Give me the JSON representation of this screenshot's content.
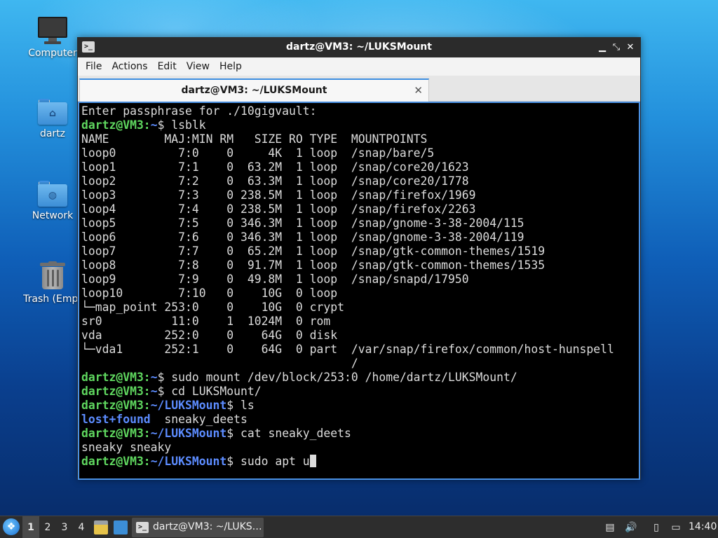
{
  "desktop": {
    "icons": [
      {
        "label": "Computer",
        "icon": "computer-icon"
      },
      {
        "label": "dartz",
        "icon": "home-folder-icon"
      },
      {
        "label": "Network",
        "icon": "network-folder-icon"
      },
      {
        "label": "Trash (Empt",
        "icon": "trash-icon"
      }
    ]
  },
  "window": {
    "title": "dartz@VM3: ~/LUKSMount",
    "controls": {
      "minimize": "▁",
      "maximize": "⤡",
      "close": "✕"
    },
    "menu": [
      "File",
      "Actions",
      "Edit",
      "View",
      "Help"
    ],
    "tab": {
      "label": "dartz@VM3: ~/LUKSMount",
      "close": "✕"
    }
  },
  "terminal": {
    "colors": {
      "user": "#5fd75f",
      "path": "#5c8cff",
      "text": "#dcdcdc",
      "bg": "#000000"
    },
    "lines": [
      [
        {
          "t": "Enter passphrase for ./10gigvault:"
        }
      ],
      [
        {
          "t": "dartz@VM3:",
          "c": "user"
        },
        {
          "t": "~",
          "c": "path"
        },
        {
          "t": "$ lsblk"
        }
      ],
      [
        {
          "t": "NAME        MAJ:MIN RM   SIZE RO TYPE  MOUNTPOINTS"
        }
      ],
      [
        {
          "t": "loop0         7:0    0     4K  1 loop  /snap/bare/5"
        }
      ],
      [
        {
          "t": "loop1         7:1    0  63.2M  1 loop  /snap/core20/1623"
        }
      ],
      [
        {
          "t": "loop2         7:2    0  63.3M  1 loop  /snap/core20/1778"
        }
      ],
      [
        {
          "t": "loop3         7:3    0 238.5M  1 loop  /snap/firefox/1969"
        }
      ],
      [
        {
          "t": "loop4         7:4    0 238.5M  1 loop  /snap/firefox/2263"
        }
      ],
      [
        {
          "t": "loop5         7:5    0 346.3M  1 loop  /snap/gnome-3-38-2004/115"
        }
      ],
      [
        {
          "t": "loop6         7:6    0 346.3M  1 loop  /snap/gnome-3-38-2004/119"
        }
      ],
      [
        {
          "t": "loop7         7:7    0  65.2M  1 loop  /snap/gtk-common-themes/1519"
        }
      ],
      [
        {
          "t": "loop8         7:8    0  91.7M  1 loop  /snap/gtk-common-themes/1535"
        }
      ],
      [
        {
          "t": "loop9         7:9    0  49.8M  1 loop  /snap/snapd/17950"
        }
      ],
      [
        {
          "t": "loop10        7:10   0    10G  0 loop"
        }
      ],
      [
        {
          "t": "└─map_point 253:0    0    10G  0 crypt"
        }
      ],
      [
        {
          "t": "sr0          11:0    1  1024M  0 rom"
        }
      ],
      [
        {
          "t": "vda         252:0    0    64G  0 disk"
        }
      ],
      [
        {
          "t": "└─vda1      252:1    0    64G  0 part  /var/snap/firefox/common/host-hunspell"
        }
      ],
      [
        {
          "t": "                                       /"
        }
      ],
      [
        {
          "t": "dartz@VM3:",
          "c": "user"
        },
        {
          "t": "~",
          "c": "path"
        },
        {
          "t": "$ sudo mount /dev/block/253:0 /home/dartz/LUKSMount/"
        }
      ],
      [
        {
          "t": "dartz@VM3:",
          "c": "user"
        },
        {
          "t": "~",
          "c": "path"
        },
        {
          "t": "$ cd LUKSMount/"
        }
      ],
      [
        {
          "t": "dartz@VM3:",
          "c": "user"
        },
        {
          "t": "~/LUKSMount",
          "c": "path"
        },
        {
          "t": "$ ls"
        }
      ],
      [
        {
          "t": "lost+found",
          "c": "dir"
        },
        {
          "t": "  sneaky_deets"
        }
      ],
      [
        {
          "t": "dartz@VM3:",
          "c": "user"
        },
        {
          "t": "~/LUKSMount",
          "c": "path"
        },
        {
          "t": "$ cat sneaky_deets"
        }
      ],
      [
        {
          "t": "sneaky sneaky"
        }
      ],
      [
        {
          "t": "dartz@VM3:",
          "c": "user"
        },
        {
          "t": "~/LUKSMount",
          "c": "path"
        },
        {
          "t": "$ sudo apt u"
        },
        {
          "cursor": true
        }
      ]
    ]
  },
  "taskbar": {
    "workspaces": [
      "1",
      "2",
      "3",
      "4"
    ],
    "active_workspace": "1",
    "task": {
      "label": "dartz@VM3: ~/LUKS…",
      "icon": "terminal-icon"
    },
    "clock": "14:40"
  }
}
